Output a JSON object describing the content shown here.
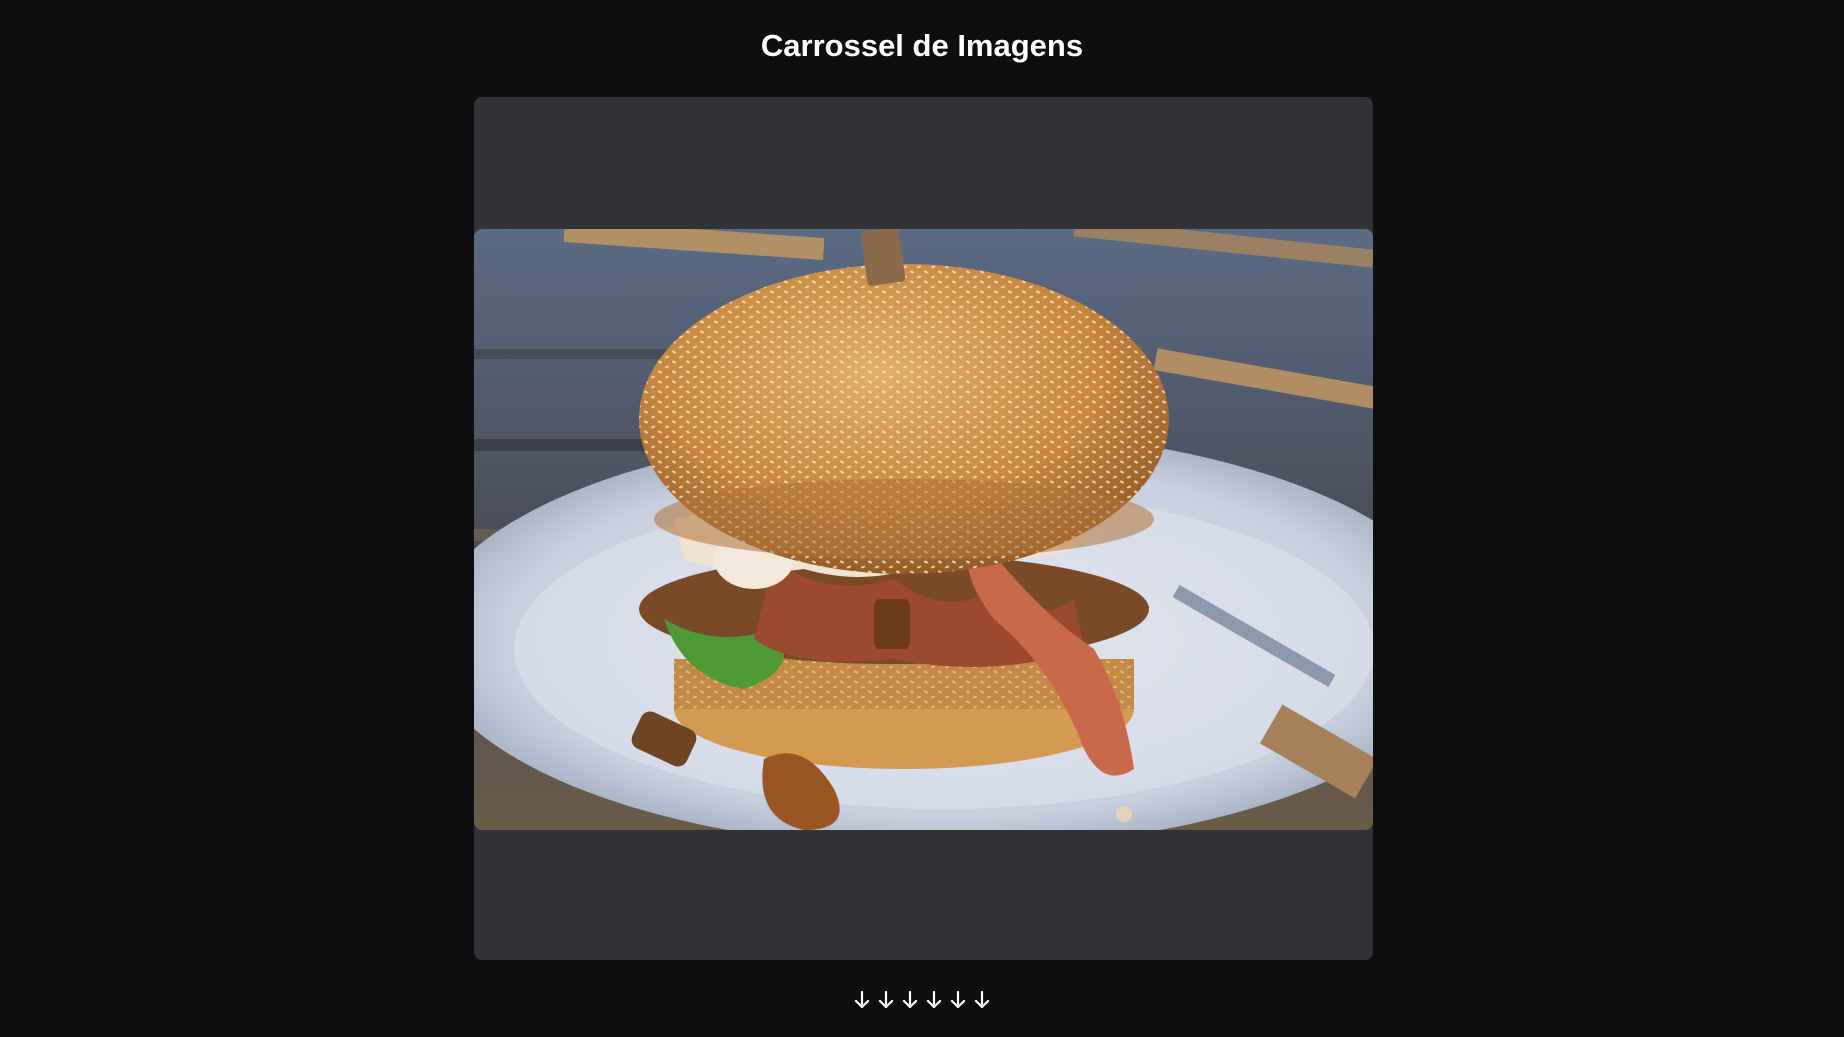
{
  "page": {
    "title": "Carrossel de Imagens"
  },
  "carousel": {
    "current_image": "burger-photo",
    "indicators": [
      {
        "icon": "arrow-down-icon"
      },
      {
        "icon": "arrow-down-icon"
      },
      {
        "icon": "arrow-down-icon"
      },
      {
        "icon": "arrow-down-icon"
      },
      {
        "icon": "arrow-down-icon"
      },
      {
        "icon": "arrow-down-icon"
      }
    ]
  },
  "colors": {
    "background": "#0e0e10",
    "carousel_bg": "#313136",
    "text": "#ffffff"
  }
}
